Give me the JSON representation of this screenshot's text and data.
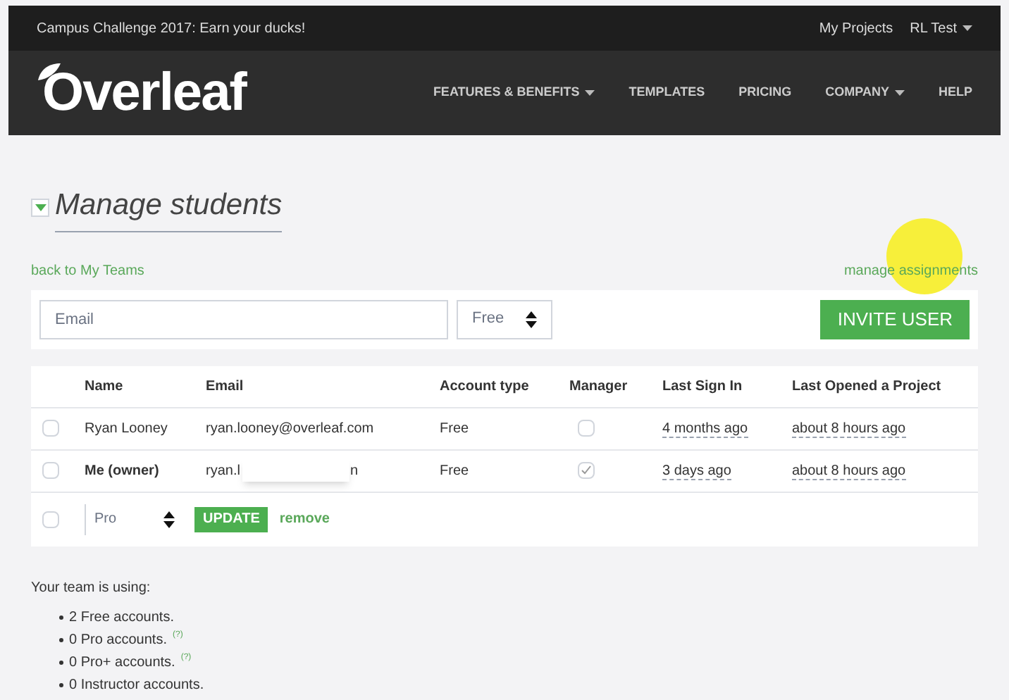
{
  "top_bar": {
    "announcement": "Campus Challenge 2017: Earn your ducks!",
    "links": [
      {
        "label": "My Projects",
        "dropdown": false
      },
      {
        "label": "RL Test",
        "dropdown": true
      }
    ]
  },
  "nav": {
    "logo": "Overleaf",
    "items": [
      {
        "label": "FEATURES & BENEFITS",
        "dropdown": true
      },
      {
        "label": "TEMPLATES",
        "dropdown": false
      },
      {
        "label": "PRICING",
        "dropdown": false
      },
      {
        "label": "COMPANY",
        "dropdown": true
      },
      {
        "label": "HELP",
        "dropdown": false
      }
    ]
  },
  "heading": {
    "title": "Manage students",
    "expanded": true
  },
  "back_link": "back to My Teams",
  "manage_link": "manage assignments",
  "invite": {
    "email_placeholder": "Email",
    "account_type": "Free",
    "button": "INVITE USER"
  },
  "table": {
    "columns": [
      "Name",
      "Email",
      "Account type",
      "Manager",
      "Last Sign In",
      "Last Opened a Project"
    ],
    "rows": [
      {
        "name": "Ryan Looney",
        "owner": false,
        "email": "ryan.looney@overleaf.com",
        "account_type": "Free",
        "manager": false,
        "selected": false,
        "last_sign_in": "4 months ago",
        "last_opened": "about 8 hours ago"
      },
      {
        "name": "Me (owner)",
        "owner": true,
        "email": "ryan.l",
        "email_tail": "n",
        "account_type": "Free",
        "manager": true,
        "selected": false,
        "last_sign_in": "3 days ago",
        "last_opened": "about 8 hours ago"
      }
    ],
    "bulk": {
      "selected": false,
      "account_type": "Pro",
      "update": "UPDATE",
      "remove": "remove"
    }
  },
  "usage": {
    "title": "Your team is using:",
    "items": [
      {
        "text": "2 Free accounts."
      },
      {
        "text": "0 Pro accounts.",
        "help": "(?)"
      },
      {
        "text": "0 Pro+ accounts.",
        "help": "(?)"
      },
      {
        "text": "0 Instructor accounts."
      }
    ]
  }
}
